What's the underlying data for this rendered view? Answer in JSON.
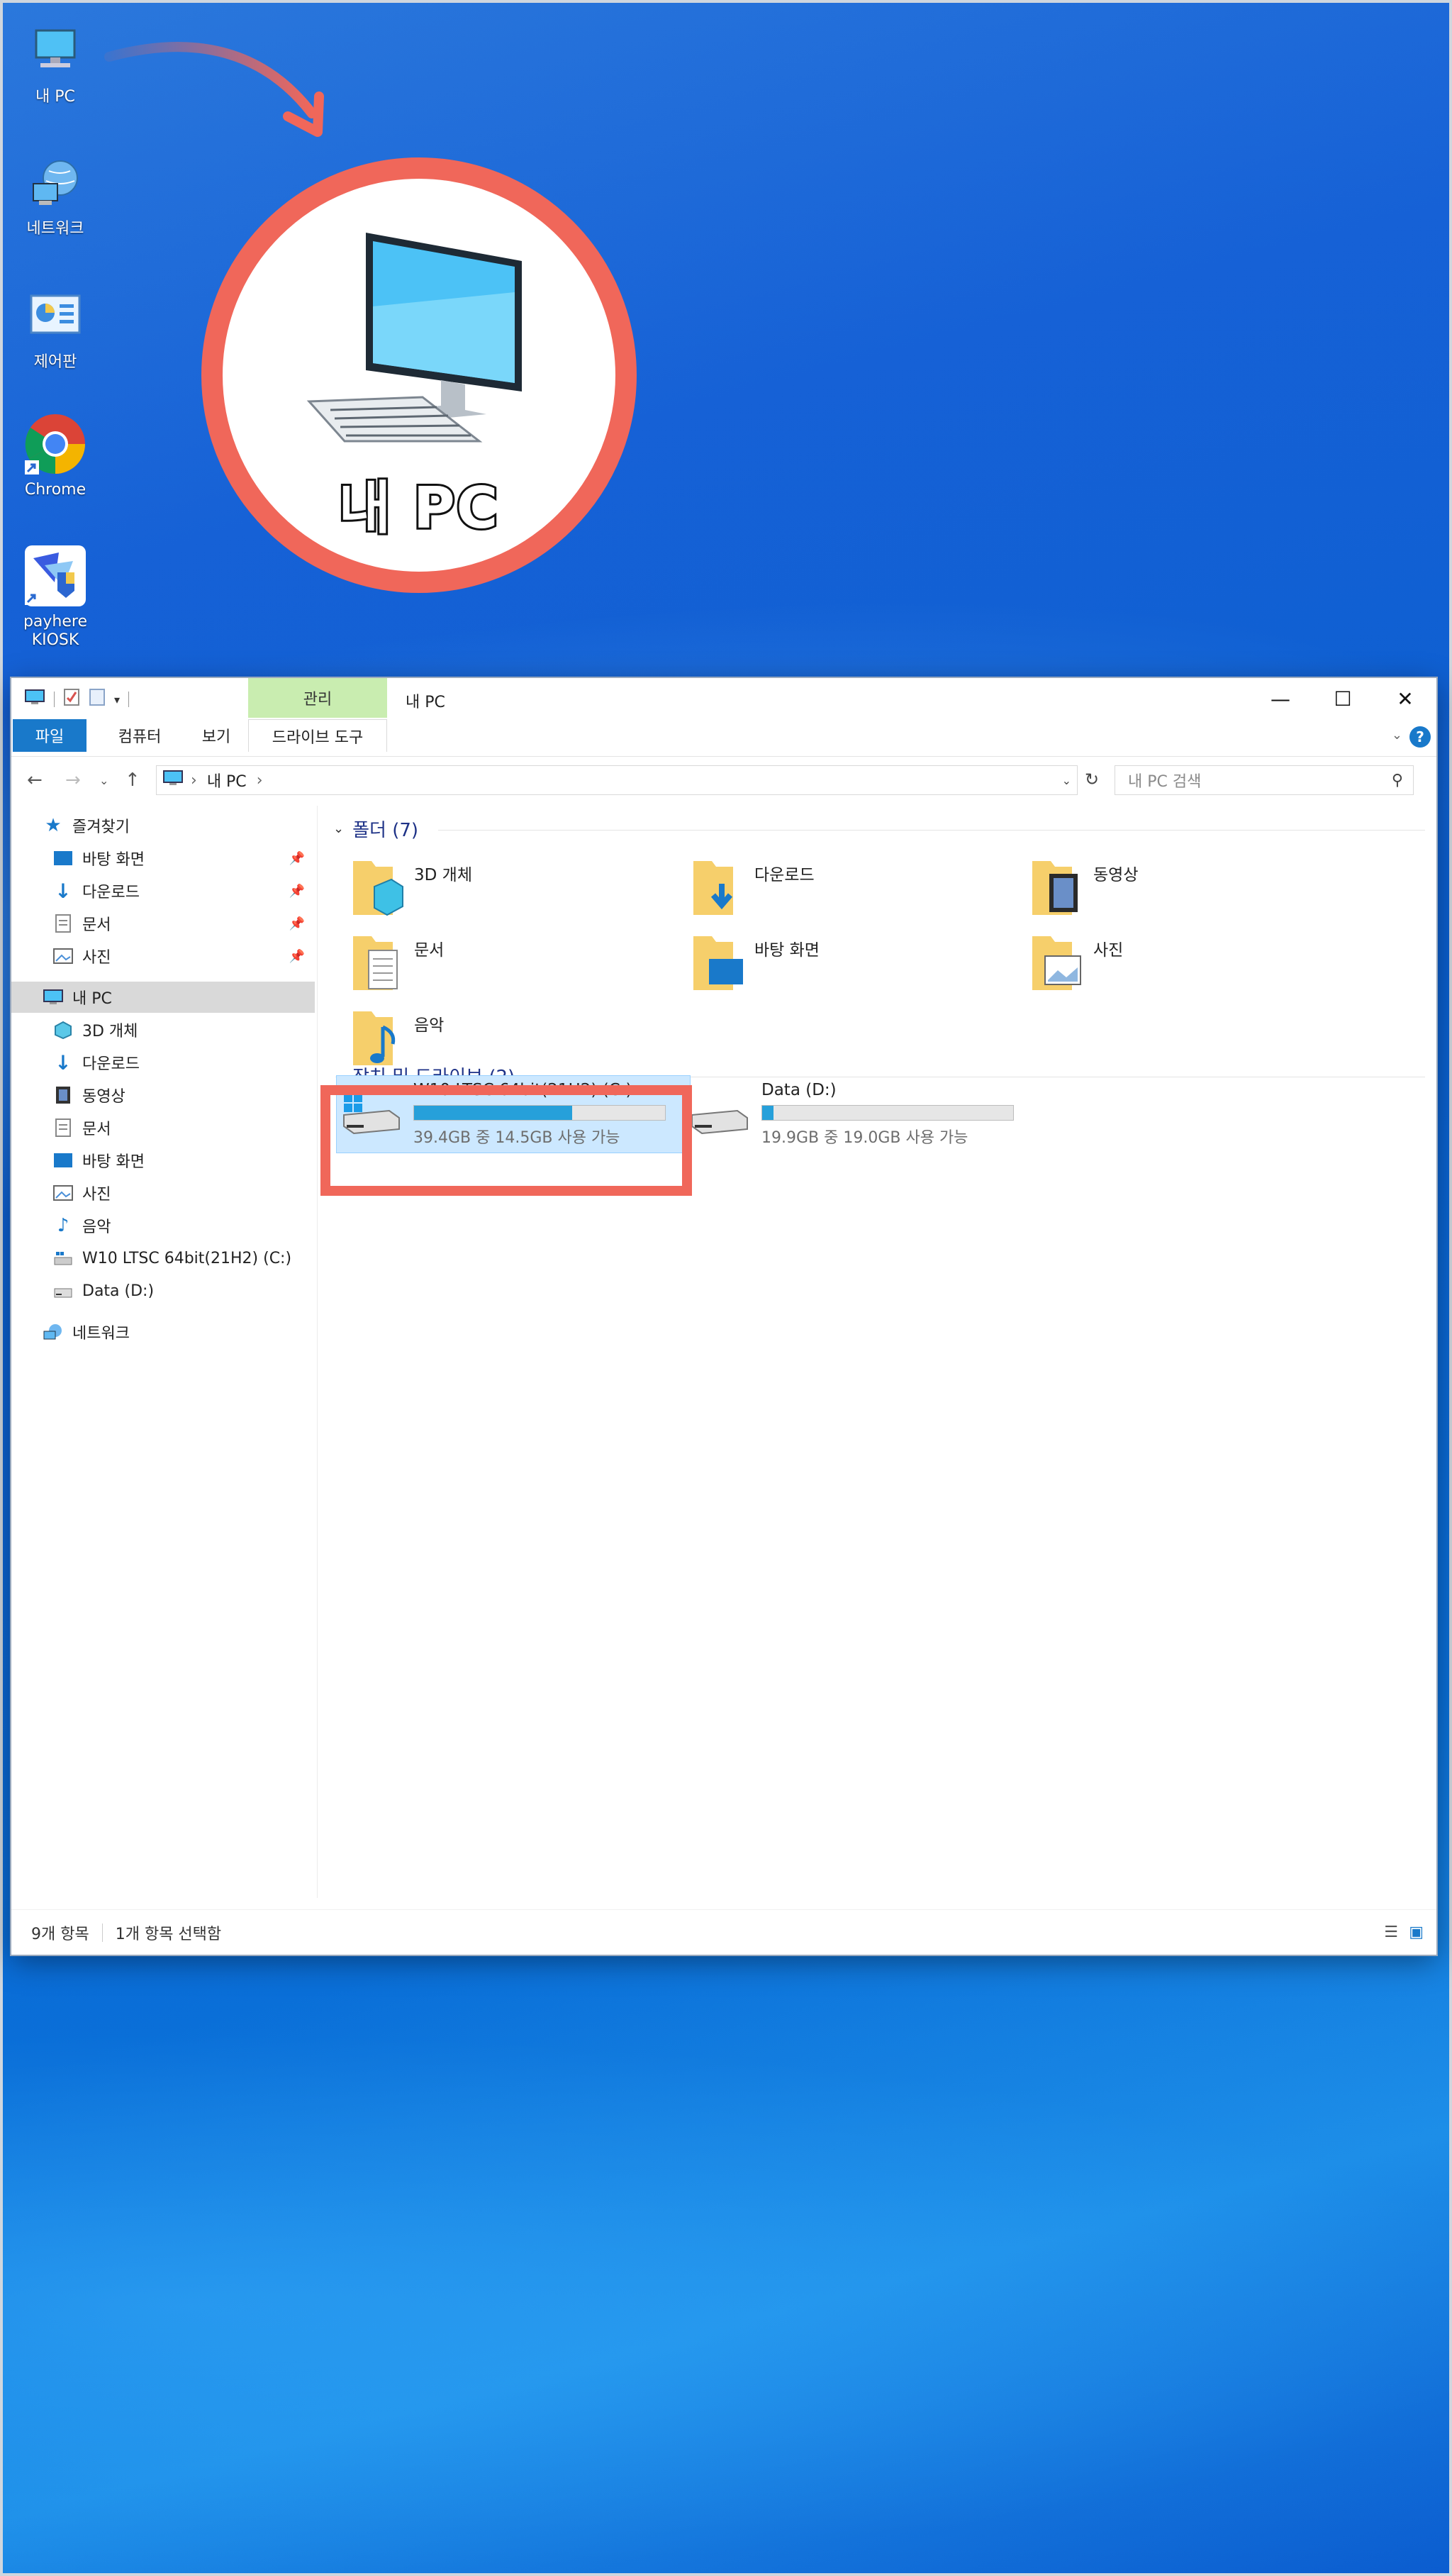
{
  "desktop": {
    "icons": [
      {
        "name": "this-pc",
        "label": "내 PC"
      },
      {
        "name": "network",
        "label": "네트워크"
      },
      {
        "name": "control-panel",
        "label": "제어판"
      },
      {
        "name": "chrome",
        "label": "Chrome"
      },
      {
        "name": "payhere-kiosk",
        "label": "payhere KIOSK"
      }
    ],
    "callout_label": "내 PC",
    "accent_color": "#f0675a"
  },
  "window": {
    "title": "내 PC",
    "context_tab": "관리",
    "tabs": [
      "파일",
      "컴퓨터",
      "보기",
      "드라이브 도구"
    ],
    "address_path": "내 PC",
    "search_placeholder": "내 PC 검색",
    "help": "?",
    "controls": {
      "minimize": "—",
      "maximize": "☐",
      "close": "✕"
    }
  },
  "nav": {
    "quick_access": "즐겨찾기",
    "pinned": [
      "바탕 화면",
      "다운로드",
      "문서",
      "사진"
    ],
    "this_pc": "내 PC",
    "pc_items": [
      "3D 개체",
      "다운로드",
      "동영상",
      "문서",
      "바탕 화면",
      "사진",
      "음악",
      "W10 LTSC 64bit(21H2) (C:)",
      "Data (D:)"
    ],
    "network": "네트워크"
  },
  "content": {
    "folders_header": "폴더 (7)",
    "folders": [
      "3D 개체",
      "다운로드",
      "동영상",
      "문서",
      "바탕 화면",
      "사진",
      "음악"
    ],
    "drives_header": "장치 및 드라이브 (2)",
    "drives": [
      {
        "name": "W10 LTSC 64bit(21H2) (C:)",
        "info": "39.4GB 중 14.5GB 사용 가능",
        "used_fraction": 0.63
      },
      {
        "name": "Data (D:)",
        "info": "19.9GB 중 19.0GB 사용 가능",
        "used_fraction": 0.045
      }
    ]
  },
  "status": {
    "items": "9개 항목",
    "selected": "1개 항목 선택함"
  }
}
